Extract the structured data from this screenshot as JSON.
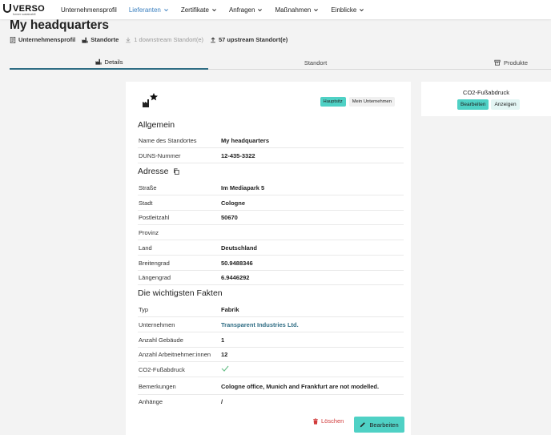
{
  "brand": {
    "name": "VERSO",
    "tagline": "former sustainabill"
  },
  "nav": {
    "items": [
      {
        "label": "Unternehmensprofil",
        "active": false,
        "dropdown": false
      },
      {
        "label": "Lieferanten",
        "active": true,
        "dropdown": true
      },
      {
        "label": "Zertifikate",
        "active": false,
        "dropdown": true
      },
      {
        "label": "Anfragen",
        "active": false,
        "dropdown": true
      },
      {
        "label": "Maßnahmen",
        "active": false,
        "dropdown": true
      },
      {
        "label": "Einblicke",
        "active": false,
        "dropdown": true
      }
    ]
  },
  "page": {
    "title": "My headquarters"
  },
  "subinfo": {
    "profile": "Unternehmensprofil",
    "sites": "Standorte",
    "downstream": "1 downstream Standort(e)",
    "upstream": "57 upstream Standort(e)"
  },
  "tabs": [
    {
      "label": "Details",
      "icon": "factory-icon"
    },
    {
      "label": "Standort",
      "icon": ""
    },
    {
      "label": "Produkte",
      "icon": "box-icon"
    }
  ],
  "badges": {
    "hq": "Hauptsitz",
    "mine": "Mein Unternehmen"
  },
  "sections": {
    "general": "Allgemein",
    "address": "Adresse",
    "facts": "Die wichtigsten Fakten"
  },
  "general": [
    {
      "key": "Name des Standortes",
      "value": "My headquarters"
    },
    {
      "key": "DUNS-Nummer",
      "value": "12-435-3322"
    }
  ],
  "address": [
    {
      "key": "Straße",
      "value": "Im Mediapark 5"
    },
    {
      "key": "Stadt",
      "value": "Cologne"
    },
    {
      "key": "Postleitzahl",
      "value": "50670"
    },
    {
      "key": "Provinz",
      "value": ""
    },
    {
      "key": "Land",
      "value": "Deutschland"
    },
    {
      "key": "Breitengrad",
      "value": "50.9488346"
    },
    {
      "key": "Längengrad",
      "value": "6.9446292"
    }
  ],
  "facts": [
    {
      "key": "Typ",
      "value": "Fabrik"
    },
    {
      "key": "Unternehmen",
      "value": "Transparent Industries Ltd."
    },
    {
      "key": "Anzahl Gebäude",
      "value": "1"
    },
    {
      "key": "Anzahl Arbeitnehmer:innen",
      "value": "12"
    },
    {
      "key": "CO2-Fußabdruck",
      "value": ""
    },
    {
      "key": "Bemerkungen",
      "value": "Cologne office, Munich and Frankfurt are not modelled."
    },
    {
      "key": "Anhänge",
      "value": "/"
    }
  ],
  "actions": {
    "delete": "Löschen",
    "edit": "Bearbeiten"
  },
  "co2": {
    "title": "CO2-Fußabdruck",
    "edit": "Bearbeiten",
    "show": "Anzeigen"
  },
  "colors": {
    "accent": "#4fd1c5",
    "link": "#2f6d84",
    "nav_active": "#3a7fbf",
    "danger": "#d13b3b"
  }
}
